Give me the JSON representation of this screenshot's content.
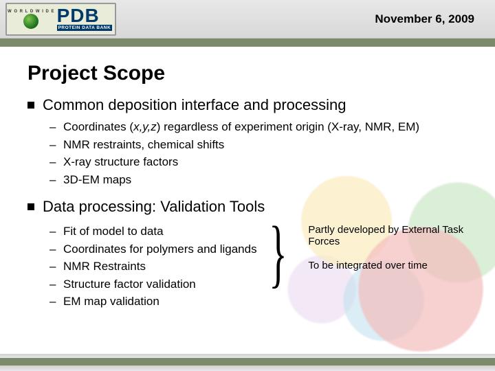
{
  "header": {
    "date": "November 6, 2009"
  },
  "logo": {
    "top": "W O R L D W I D E",
    "main": "PDB",
    "sub": "PROTEIN DATA BANK"
  },
  "title": "Project Scope",
  "s1": {
    "head": "Common deposition interface and processing",
    "i0a": "Coordinates (",
    "i0b": "x,y,z",
    "i0c": ") regardless of experiment origin (X-ray, NMR, EM)",
    "i1": "NMR restraints, chemical shifts",
    "i2": "X-ray structure factors",
    "i3": "3D-EM maps"
  },
  "s2": {
    "head": "Data processing: Validation Tools",
    "i0": "Fit of model to data",
    "i1": "Coordinates for polymers and ligands",
    "i2": "NMR Restraints",
    "i3": "Structure factor validation",
    "i4": "EM map validation",
    "n1": "Partly developed by External Task Forces",
    "n2": "To be integrated over time"
  }
}
